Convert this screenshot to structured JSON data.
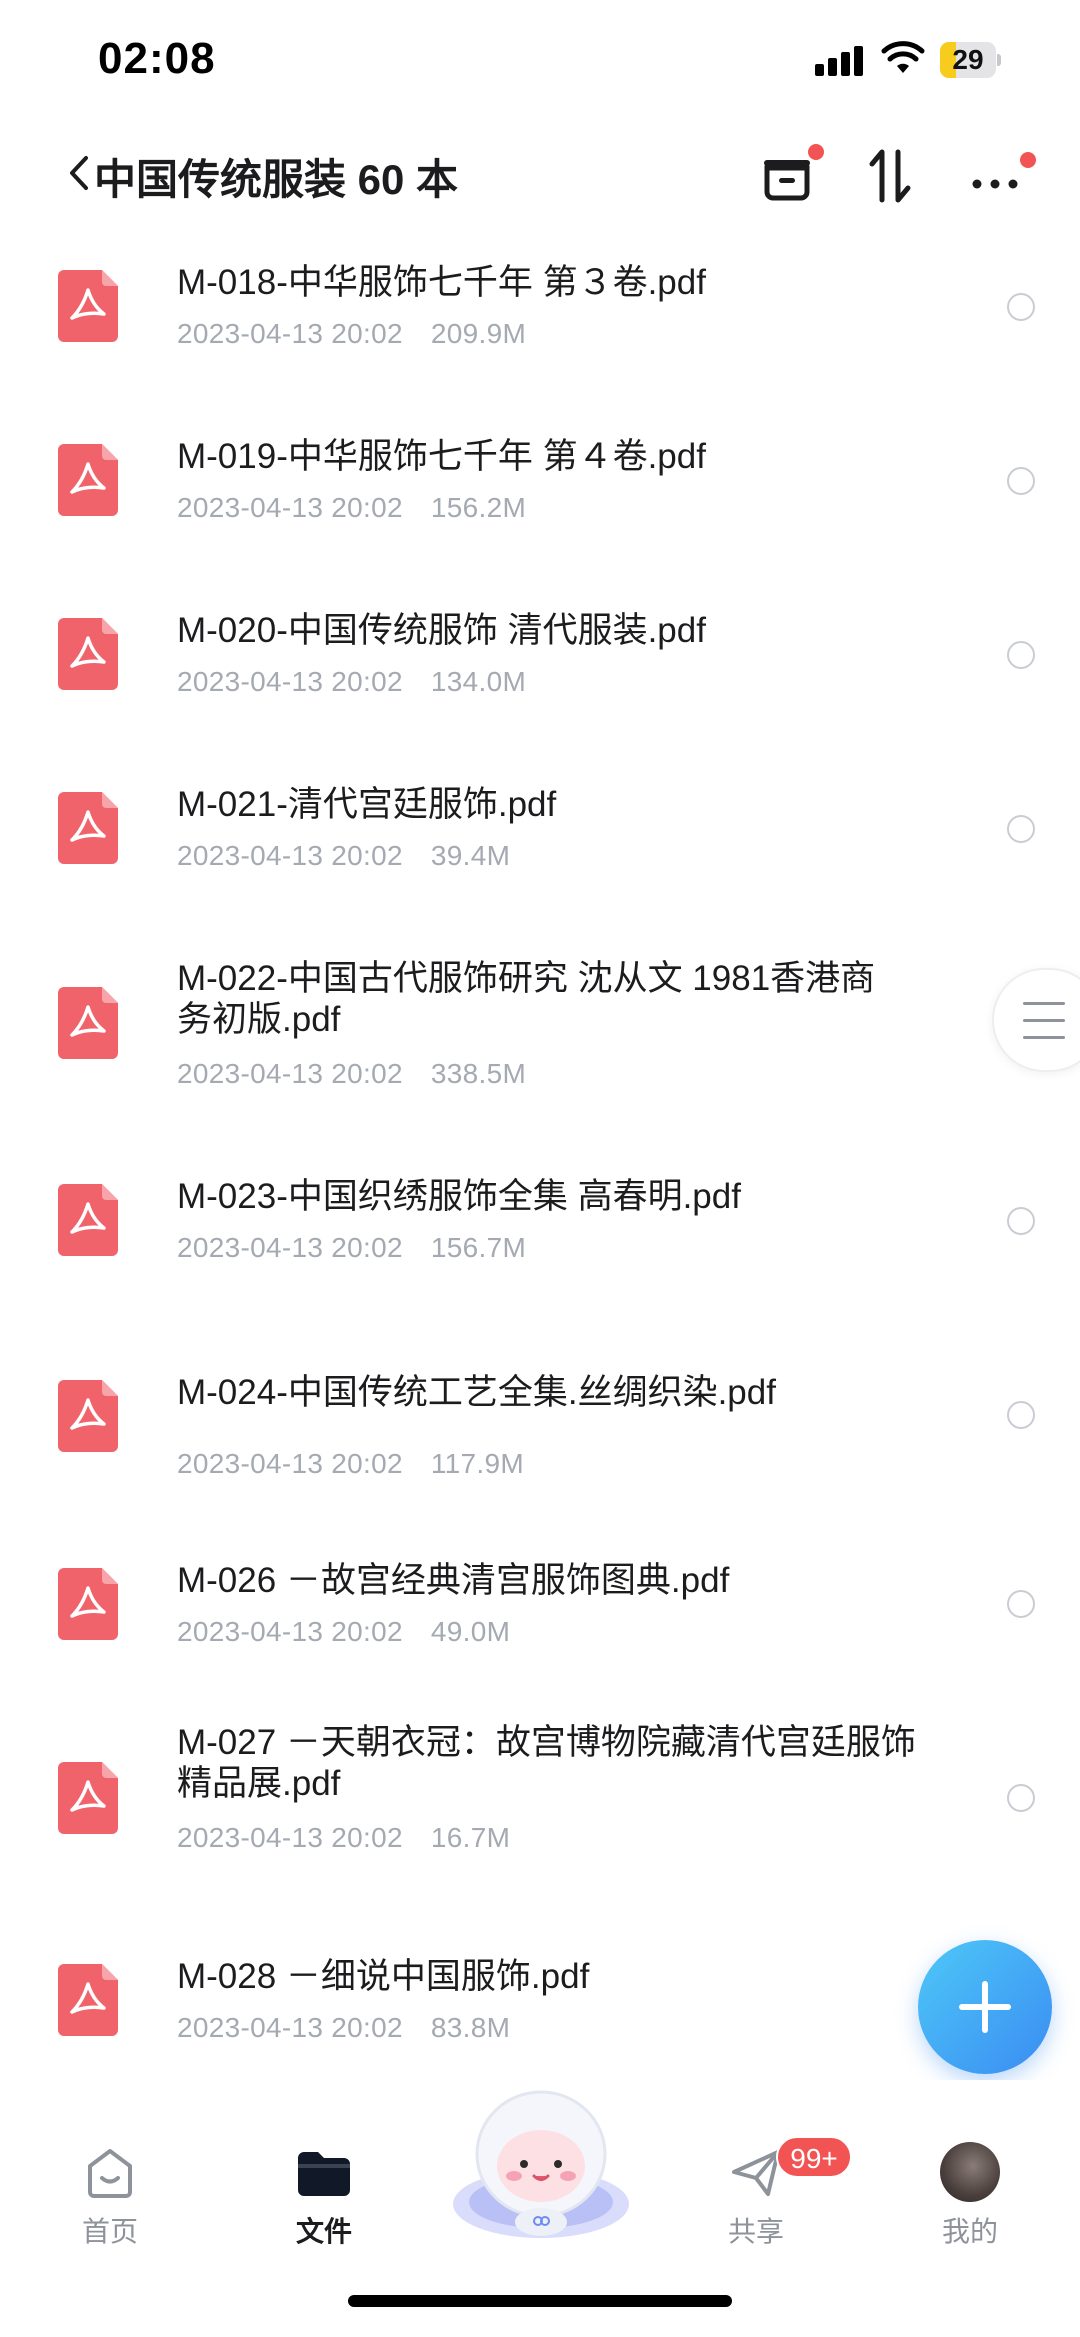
{
  "status_bar": {
    "time": "02:08",
    "battery": "29",
    "battery_level": 0.29
  },
  "nav": {
    "title": "中国传统服装 60 本",
    "icons": [
      "back-icon",
      "archive-icon",
      "sort-icon",
      "more-icon"
    ]
  },
  "files": [
    {
      "name": "M-018-中华服饰七千年  第３卷.pdf",
      "date": "2023-04-13 20:02",
      "size": "209.9M"
    },
    {
      "name": "M-019-中华服饰七千年  第４卷.pdf",
      "date": "2023-04-13 20:02",
      "size": "156.2M"
    },
    {
      "name": "M-020-中国传统服饰  清代服装.pdf",
      "date": "2023-04-13 20:02",
      "size": "134.0M"
    },
    {
      "name": "M-021-清代宫廷服饰.pdf",
      "date": "2023-04-13 20:02",
      "size": "39.4M"
    },
    {
      "name": "M-022-中国古代服饰研究 沈从文 1981香港商务初版.pdf",
      "date": "2023-04-13 20:02",
      "size": "338.5M"
    },
    {
      "name": "M-023-中国织绣服饰全集 高春明.pdf",
      "date": "2023-04-13 20:02",
      "size": "156.7M"
    },
    {
      "name": "M-024-中国传统工艺全集.丝绸织染.pdf",
      "date": "2023-04-13 20:02",
      "size": "117.9M"
    },
    {
      "name": "M-026 －故宫经典清宫服饰图典.pdf",
      "date": "2023-04-13 20:02",
      "size": "49.0M"
    },
    {
      "name": "M-027 －天朝衣冠：故宫博物院藏清代宫廷服饰精品展.pdf",
      "date": "2023-04-13 20:02",
      "size": "16.7M"
    },
    {
      "name": "M-028 －细说中国服饰.pdf",
      "date": "2023-04-13 20:02",
      "size": "83.8M"
    }
  ],
  "tabs": [
    {
      "label": "首页",
      "icon": "home-icon"
    },
    {
      "label": "文件",
      "icon": "folder-icon"
    },
    {
      "label": "",
      "icon": "mascot-icon"
    },
    {
      "label": "共享",
      "icon": "share-icon"
    },
    {
      "label": "我的",
      "icon": "avatar"
    }
  ],
  "share_badge": "99+",
  "colors": {
    "accent": "#3a8cf2",
    "pdf_icon": "#f0636b",
    "badge": "#f25454",
    "meta_text": "#a5a9b1"
  }
}
